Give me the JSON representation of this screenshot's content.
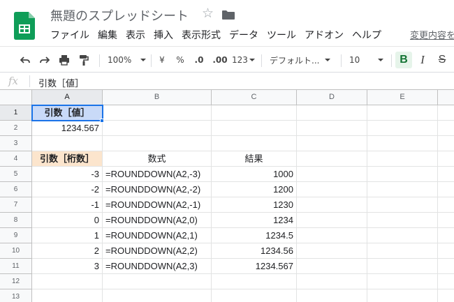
{
  "app": {
    "title": "無題のスプレッドシート",
    "changes_link": "変更内容を"
  },
  "menu": [
    "ファイル",
    "編集",
    "表示",
    "挿入",
    "表示形式",
    "データ",
    "ツール",
    "アドオン",
    "ヘルプ"
  ],
  "toolbar": {
    "zoom": "100%",
    "currency": "¥",
    "percent": "%",
    "decrease_decimal": ".0",
    "increase_decimal": ".00",
    "more_formats": "123",
    "font": "デフォルト...",
    "font_size": "10",
    "bold": "B",
    "italic": "I",
    "strikethrough": "S"
  },
  "formula_bar": {
    "icon": "fx",
    "content": "引数［値］"
  },
  "columns": [
    "A",
    "B",
    "C",
    "D",
    "E"
  ],
  "rows": [
    "1",
    "2",
    "3",
    "4",
    "5",
    "6",
    "7",
    "8",
    "9",
    "10",
    "11",
    "12",
    "13"
  ],
  "cells": {
    "A1": "引数［値］",
    "A2": "1234.567",
    "A4": "引数［桁数］",
    "B4": "数式",
    "C4": "結果",
    "A5": "-3",
    "B5": "=ROUNDDOWN(A2,-3)",
    "C5": "1000",
    "A6": "-2",
    "B6": "=ROUNDDOWN(A2,-2)",
    "C6": "1200",
    "A7": "-1",
    "B7": "=ROUNDDOWN(A2,-1)",
    "C7": "1230",
    "A8": "0",
    "B8": "=ROUNDDOWN(A2,0)",
    "C8": "1234",
    "A9": "1",
    "B9": "=ROUNDDOWN(A2,1)",
    "C9": "1234.5",
    "A10": "2",
    "B10": "=ROUNDDOWN(A2,2)",
    "C10": "1234.56",
    "A11": "3",
    "B11": "=ROUNDDOWN(A2,3)",
    "C11": "1234.567"
  },
  "selected_cell": "A1",
  "colors": {
    "selection": "#1a73e8",
    "header_blue": "#c9daf8",
    "header_orange": "#fce5cd",
    "logo_green": "#0f9d58"
  }
}
